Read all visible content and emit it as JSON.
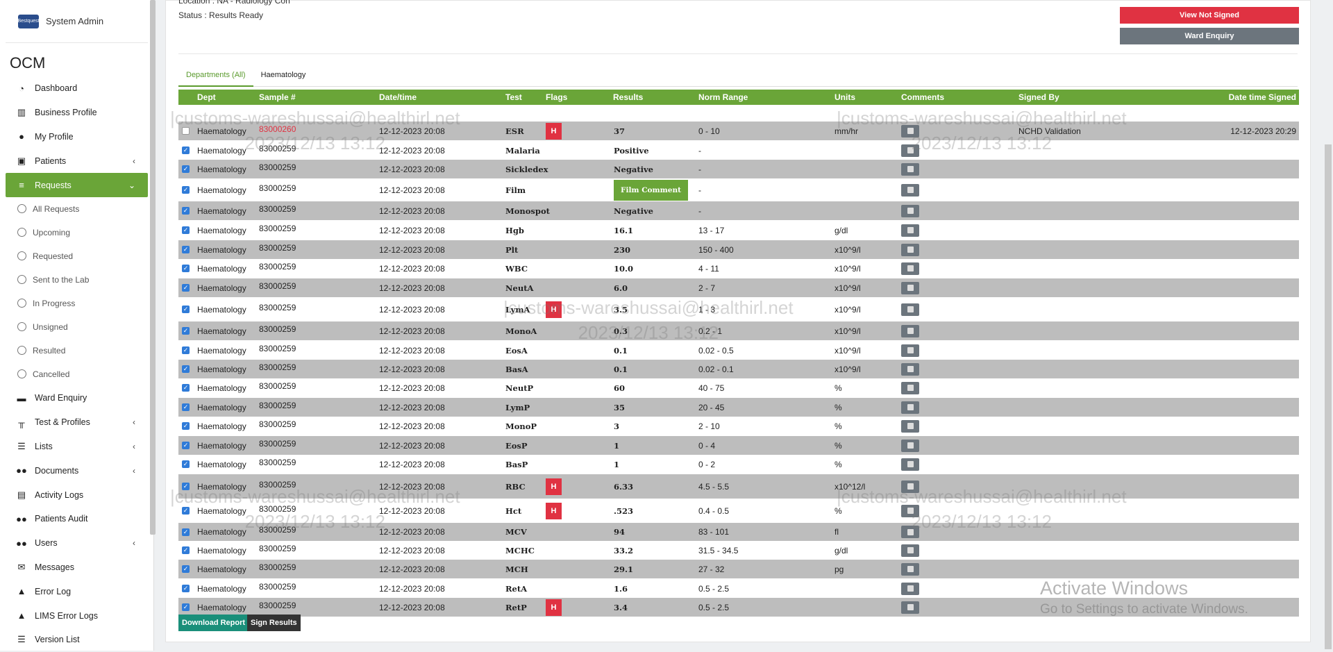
{
  "sidebar": {
    "user_name": "System Admin",
    "logo_text": "Bestquest",
    "app_title": "OCM",
    "items": [
      {
        "label": "Dashboard",
        "icon": "dashboard-icon"
      },
      {
        "label": "Business Profile",
        "icon": "building-icon"
      },
      {
        "label": "My Profile",
        "icon": "user-icon"
      },
      {
        "label": "Patients",
        "icon": "patient-icon"
      },
      {
        "label": "Requests",
        "icon": "database-icon"
      },
      {
        "label": "All Requests"
      },
      {
        "label": "Upcoming"
      },
      {
        "label": "Requested"
      },
      {
        "label": "Sent to the Lab"
      },
      {
        "label": "In Progress"
      },
      {
        "label": "Unsigned"
      },
      {
        "label": "Resulted"
      },
      {
        "label": "Cancelled"
      },
      {
        "label": "Ward Enquiry",
        "icon": "bed-icon"
      },
      {
        "label": "Test & Profiles",
        "icon": "test-tube-icon"
      },
      {
        "label": "Lists",
        "icon": "list-icon"
      },
      {
        "label": "Documents",
        "icon": "users-icon"
      },
      {
        "label": "Activity Logs",
        "icon": "bank-icon"
      },
      {
        "label": "Patients Audit",
        "icon": "users-icon"
      },
      {
        "label": "Users",
        "icon": "users-icon"
      },
      {
        "label": "Messages",
        "icon": "envelope-icon"
      },
      {
        "label": "Error Log",
        "icon": "warning-icon"
      },
      {
        "label": "LIMS Error Logs",
        "icon": "warning-icon"
      },
      {
        "label": "Version List",
        "icon": "list-icon"
      }
    ]
  },
  "header": {
    "location": "Location : NA - Radiology Con",
    "status": "Status : Results Ready",
    "view_not_signed": "View Not Signed",
    "ward_enquiry": "Ward Enquiry"
  },
  "tabs": [
    "Departments (All)",
    "Haematology"
  ],
  "table": {
    "columns": [
      "Dept",
      "Sample #",
      "Date/time",
      "Test",
      "Flags",
      "Results",
      "Norm Range",
      "Units",
      "Comments",
      "Signed By",
      "Date time Signed"
    ],
    "rows": [
      {
        "dept": "Haematology",
        "sample": "83000260",
        "datetime": "12-12-2023 20:08",
        "test": "ESR",
        "flag": "H",
        "result": "37",
        "range": "0 - 10",
        "units": "mm/hr",
        "signed_by": "NCHD Validation",
        "signed_at": "12-12-2023 20:29"
      },
      {
        "dept": "Haematology",
        "sample": "83000259",
        "datetime": "12-12-2023 20:08",
        "test": "Malaria",
        "flag": "",
        "result": "Positive",
        "range": "-",
        "units": ""
      },
      {
        "dept": "Haematology",
        "sample": "83000259",
        "datetime": "12-12-2023 20:08",
        "test": "Sickledex",
        "flag": "",
        "result": "Negative",
        "range": "-",
        "units": ""
      },
      {
        "dept": "Haematology",
        "sample": "83000259",
        "datetime": "12-12-2023 20:08",
        "test": "Film",
        "flag": "",
        "result": "Film Comment",
        "range": "-",
        "units": ""
      },
      {
        "dept": "Haematology",
        "sample": "83000259",
        "datetime": "12-12-2023 20:08",
        "test": "Monospot",
        "flag": "",
        "result": "Negative",
        "range": "-",
        "units": ""
      },
      {
        "dept": "Haematology",
        "sample": "83000259",
        "datetime": "12-12-2023 20:08",
        "test": "Hgb",
        "flag": "",
        "result": "16.1",
        "range": "13 - 17",
        "units": "g/dl"
      },
      {
        "dept": "Haematology",
        "sample": "83000259",
        "datetime": "12-12-2023 20:08",
        "test": "Plt",
        "flag": "",
        "result": "230",
        "range": "150 - 400",
        "units": "x10^9/l"
      },
      {
        "dept": "Haematology",
        "sample": "83000259",
        "datetime": "12-12-2023 20:08",
        "test": "WBC",
        "flag": "",
        "result": "10.0",
        "range": "4 - 11",
        "units": "x10^9/l"
      },
      {
        "dept": "Haematology",
        "sample": "83000259",
        "datetime": "12-12-2023 20:08",
        "test": "NeutA",
        "flag": "",
        "result": "6.0",
        "range": "2 - 7",
        "units": "x10^9/l"
      },
      {
        "dept": "Haematology",
        "sample": "83000259",
        "datetime": "12-12-2023 20:08",
        "test": "LymA",
        "flag": "H",
        "result": "3.5",
        "range": "1 - 3",
        "units": "x10^9/l"
      },
      {
        "dept": "Haematology",
        "sample": "83000259",
        "datetime": "12-12-2023 20:08",
        "test": "MonoA",
        "flag": "",
        "result": "0.3",
        "range": "0.2 - 1",
        "units": "x10^9/l"
      },
      {
        "dept": "Haematology",
        "sample": "83000259",
        "datetime": "12-12-2023 20:08",
        "test": "EosA",
        "flag": "",
        "result": "0.1",
        "range": "0.02 - 0.5",
        "units": "x10^9/l"
      },
      {
        "dept": "Haematology",
        "sample": "83000259",
        "datetime": "12-12-2023 20:08",
        "test": "BasA",
        "flag": "",
        "result": "0.1",
        "range": "0.02 - 0.1",
        "units": "x10^9/l"
      },
      {
        "dept": "Haematology",
        "sample": "83000259",
        "datetime": "12-12-2023 20:08",
        "test": "NeutP",
        "flag": "",
        "result": "60",
        "range": "40 - 75",
        "units": "%"
      },
      {
        "dept": "Haematology",
        "sample": "83000259",
        "datetime": "12-12-2023 20:08",
        "test": "LymP",
        "flag": "",
        "result": "35",
        "range": "20 - 45",
        "units": "%"
      },
      {
        "dept": "Haematology",
        "sample": "83000259",
        "datetime": "12-12-2023 20:08",
        "test": "MonoP",
        "flag": "",
        "result": "3",
        "range": "2 - 10",
        "units": "%"
      },
      {
        "dept": "Haematology",
        "sample": "83000259",
        "datetime": "12-12-2023 20:08",
        "test": "EosP",
        "flag": "",
        "result": "1",
        "range": "0 - 4",
        "units": "%"
      },
      {
        "dept": "Haematology",
        "sample": "83000259",
        "datetime": "12-12-2023 20:08",
        "test": "BasP",
        "flag": "",
        "result": "1",
        "range": "0 - 2",
        "units": "%"
      },
      {
        "dept": "Haematology",
        "sample": "83000259",
        "datetime": "12-12-2023 20:08",
        "test": "RBC",
        "flag": "H",
        "result": "6.33",
        "range": "4.5 - 5.5",
        "units": "x10^12/l"
      },
      {
        "dept": "Haematology",
        "sample": "83000259",
        "datetime": "12-12-2023 20:08",
        "test": "Hct",
        "flag": "H",
        "result": ".523",
        "range": "0.4 - 0.5",
        "units": "%"
      },
      {
        "dept": "Haematology",
        "sample": "83000259",
        "datetime": "12-12-2023 20:08",
        "test": "MCV",
        "flag": "",
        "result": "94",
        "range": "83 - 101",
        "units": "fl"
      },
      {
        "dept": "Haematology",
        "sample": "83000259",
        "datetime": "12-12-2023 20:08",
        "test": "MCHC",
        "flag": "",
        "result": "33.2",
        "range": "31.5 - 34.5",
        "units": "g/dl"
      },
      {
        "dept": "Haematology",
        "sample": "83000259",
        "datetime": "12-12-2023 20:08",
        "test": "MCH",
        "flag": "",
        "result": "29.1",
        "range": "27 - 32",
        "units": "pg"
      },
      {
        "dept": "Haematology",
        "sample": "83000259",
        "datetime": "12-12-2023 20:08",
        "test": "RetA",
        "flag": "",
        "result": "1.6",
        "range": "0.5 - 2.5",
        "units": ""
      },
      {
        "dept": "Haematology",
        "sample": "83000259",
        "datetime": "12-12-2023 20:08",
        "test": "RetP",
        "flag": "H",
        "result": "3.4",
        "range": "0.5 - 2.5",
        "units": ""
      }
    ]
  },
  "footer": {
    "download_report": "Download Report",
    "sign_results": "Sign Results"
  },
  "watermark": {
    "line1": "|customs-wareshussai@healthirl.net",
    "line2": "2023/12/13 13:12"
  },
  "activate_windows": {
    "title": "Activate Windows",
    "subtitle": "Go to Settings to activate Windows."
  },
  "colors": {
    "accent_green": "#6aa538",
    "danger_red": "#e03242",
    "row_gray": "#bdbdbd"
  }
}
